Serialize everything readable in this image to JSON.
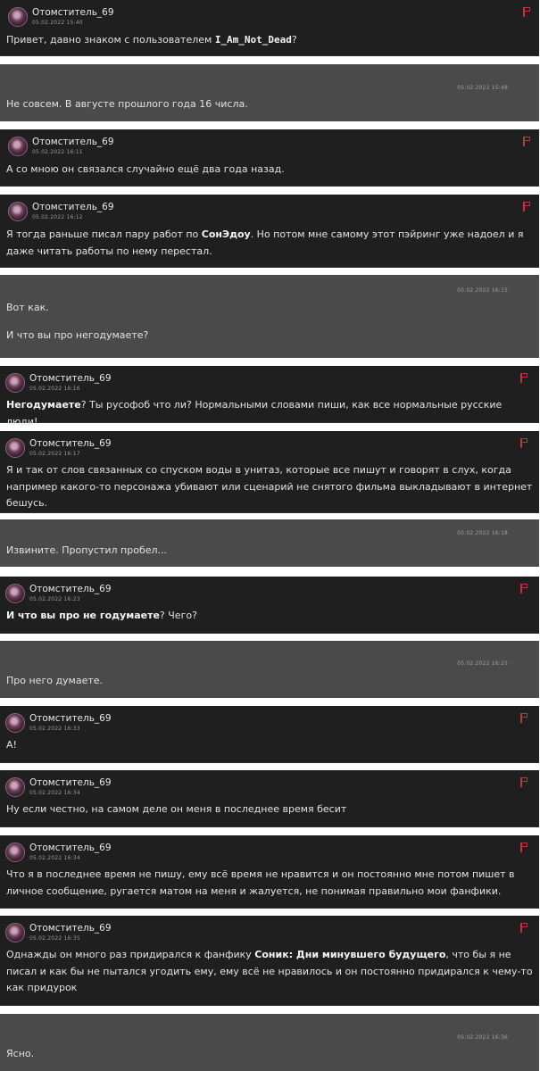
{
  "author": "Отомститель_69",
  "messages": [
    {
      "date": "05.02.2022 15:40",
      "parts": [
        "Привет, давно знаком с пользователем ",
        "I_Am_Not_Dead",
        "?"
      ]
    },
    {
      "date": "05.02.2022 15:48",
      "text": "Не совсем. В августе прошлого года 16 числа."
    },
    {
      "date": "05.02.2022 16:11",
      "text": "А со мною он связался случайно ещё два года назад."
    },
    {
      "date": "05.02.2022 16:12",
      "parts": [
        "Я тогда раньше писал пару работ по ",
        "СонЭдоу",
        ". Но потом мне самому этот пэйринг уже надоел и я даже читать работы по нему перестал."
      ]
    },
    {
      "date": "05.02.2022 16:15",
      "line1": "Вот как.",
      "line2": "И что вы про негодумаете?"
    },
    {
      "date": "05.02.2022 16:16",
      "parts": [
        "Негодумаете",
        "? Ты русофоб что ли? Нормальными словами пиши, как все нормальные русские люди!"
      ]
    },
    {
      "date": "05.02.2022 16:17",
      "text": "Я и так от слов связанных со спуском воды в унитаз, которые все пишут и говорят в слух, когда например какого-то персонажа убивают или сценарий не снятого фильма выкладывают в интернет бешусь."
    },
    {
      "date": "05.02.2022 16:18",
      "text": "Извините. Пропустил пробел..."
    },
    {
      "date": "05.02.2022 16:23",
      "parts": [
        "И что вы про не годумаете",
        "? Чего?"
      ]
    },
    {
      "date": "05.02.2022 16:25",
      "text": "Про него думаете."
    },
    {
      "date": "05.02.2022 16:33",
      "text": "А!"
    },
    {
      "date": "05.02.2022 16:34",
      "text": "Ну если честно, на самом деле он меня в последнее время бесит"
    },
    {
      "date": "05.02.2022 16:34",
      "text": "Что я в последнее время не пишу, ему всё время не нравится и он постоянно мне потом пишет в личное сообщение, ругается матом на меня и жалуется, не понимая правильно мои фанфики."
    },
    {
      "date": "05.02.2022 16:35",
      "parts": [
        "Однажды он много раз придирался к фанфику ",
        "Соник: Дни минувшего будущего",
        ", что бы я не писал и как бы не пытался угодить ему, ему всё не нравилось и он постоянно придирался к чему-то как придурок"
      ]
    },
    {
      "date": "05.02.2022 16:36",
      "text": "Ясно."
    }
  ]
}
